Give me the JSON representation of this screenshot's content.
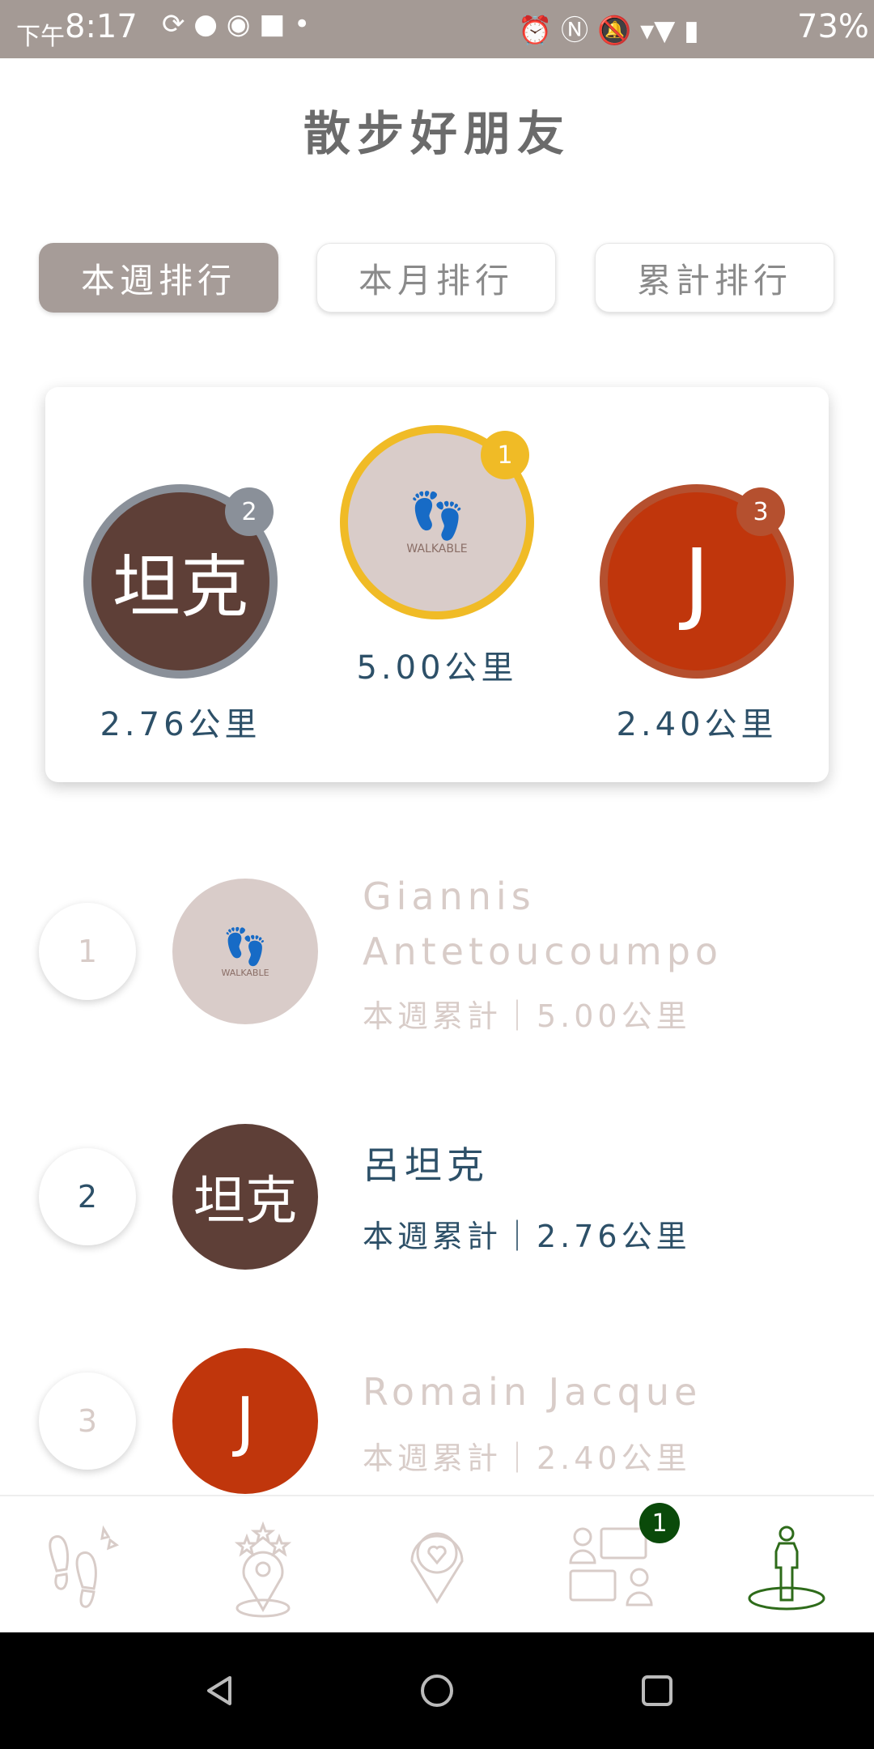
{
  "status_bar": {
    "time_prefix": "下午",
    "time": "8:17",
    "battery": "73%"
  },
  "header": {
    "title": "散步好朋友"
  },
  "tabs": [
    {
      "label": "本週排行",
      "active": true
    },
    {
      "label": "本月排行",
      "active": false
    },
    {
      "label": "累計排行",
      "active": false
    }
  ],
  "podium": [
    {
      "rank": "2",
      "avatar_text": "坦克",
      "distance": "2.76公里",
      "ring_color": "#8a9099",
      "fill": "#5e3f37"
    },
    {
      "rank": "1",
      "avatar_text": "WALKABLE",
      "distance": "5.00公里",
      "ring_color": "#f0bb26",
      "fill": "#d9ccc9"
    },
    {
      "rank": "3",
      "avatar_text": "J",
      "distance": "2.40公里",
      "ring_color": "#b5502f",
      "fill": "#c0360c"
    }
  ],
  "list": [
    {
      "rank": "1",
      "avatar_text": "WALKABLE",
      "name_line1": "Giannis",
      "name_line2": "Antetoucoumpo",
      "stat": "本週累計｜5.00公里"
    },
    {
      "rank": "2",
      "avatar_text": "坦克",
      "name_line1": "呂坦克",
      "stat": "本週累計｜2.76公里"
    },
    {
      "rank": "3",
      "avatar_text": "J",
      "name_line1": "Romain Jacque",
      "stat": "本週累計｜2.40公里"
    }
  ],
  "bottom_nav": {
    "messages_badge": "1",
    "active_color": "#2e6b1a",
    "inactive_color": "#d8ccc8"
  }
}
